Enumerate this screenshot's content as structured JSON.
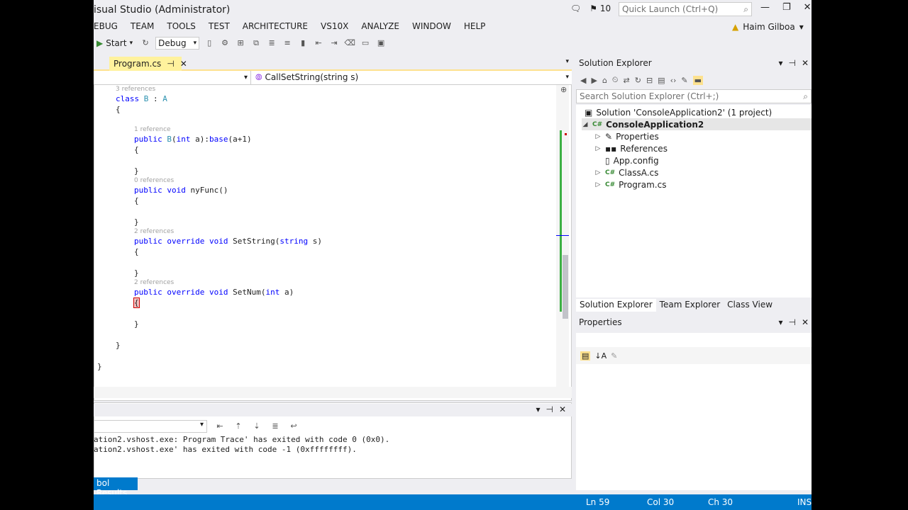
{
  "window": {
    "title": "isual Studio (Administrator)",
    "notification_count": "10",
    "quick_launch_placeholder": "Quick Launch (Ctrl+Q)",
    "user_name": "Haim Gilboa"
  },
  "menu": [
    "EBUG",
    "TEAM",
    "TOOLS",
    "TEST",
    "ARCHITECTURE",
    "VS10X",
    "ANALYZE",
    "WINDOW",
    "HELP"
  ],
  "toolbar": {
    "start_label": "Start",
    "config_value": "Debug"
  },
  "editor": {
    "tab_label": "Program.cs",
    "member_dropdown": "CallSetString(string s)",
    "code": {
      "ref_class": "3 references",
      "class_line": "class B : A",
      "open1": "{",
      "ref_ctor": "1 reference",
      "ctor_line": "public B(int a):base(a+1)",
      "ctor_open": "{",
      "ctor_close": "}",
      "ref_nyfunc": "0 references",
      "nyfunc_line": "public void nyFunc()",
      "nyfunc_open": "{",
      "nyfunc_close": "}",
      "ref_setstring": "2 references",
      "setstring_line": "public override void SetString(string s)",
      "setstring_open": "{",
      "setstring_close": "}",
      "ref_setnum": "2 references",
      "setnum_line": "public override void SetNum(int a)",
      "setnum_open": "{",
      "setnum_close": "}",
      "class_close": "}",
      "ns_close": "}"
    }
  },
  "output": {
    "lines": [
      "ation2.vshost.exe: Program Trace' has exited with code 0 (0x0).",
      "ation2.vshost.exe' has exited with code -1 (0xffffffff)."
    ],
    "bottom_tab": "bol Results"
  },
  "solution_explorer": {
    "title": "Solution Explorer",
    "search_placeholder": "Search Solution Explorer (Ctrl+;)",
    "solution": "Solution 'ConsoleApplication2' (1 project)",
    "project": "ConsoleApplication2",
    "items": [
      "Properties",
      "References",
      "App.config",
      "ClassA.cs",
      "Program.cs"
    ],
    "tabs": [
      "Solution Explorer",
      "Team Explorer",
      "Class View"
    ]
  },
  "properties": {
    "title": "Properties"
  },
  "status": {
    "line": "Ln 59",
    "col": "Col 30",
    "ch": "Ch 30",
    "mode": "INS"
  }
}
